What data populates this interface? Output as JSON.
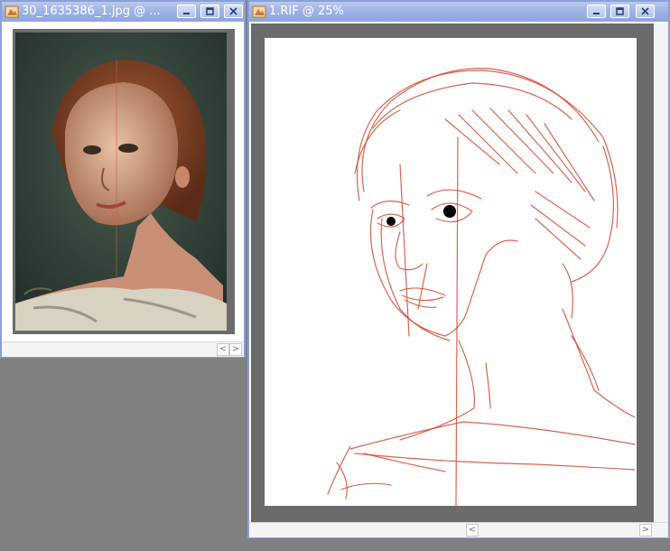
{
  "windows": {
    "reference": {
      "title": "30_1635386_1.jpg @ ..."
    },
    "canvas": {
      "title": "1.RIF @ 25%"
    }
  },
  "buttons": {
    "minimize_icon": "minimize-icon",
    "maximize_icon": "maximize-icon",
    "close_icon": "close-icon"
  },
  "colors": {
    "titlebar": "#9fb3e6",
    "workspace": "#808080",
    "canvas_gutter": "#6b6b6b",
    "sketch_stroke": "#d24a32"
  }
}
